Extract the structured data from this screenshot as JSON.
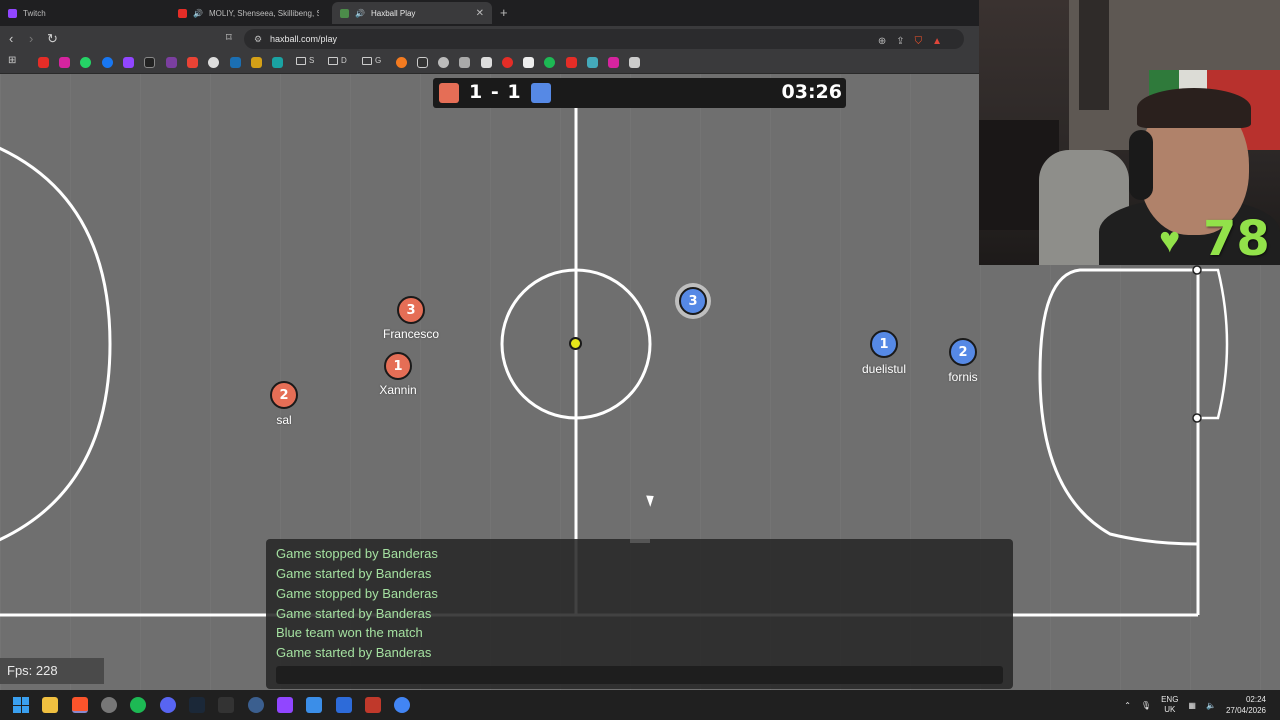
{
  "tabs": [
    {
      "title": "Twitch",
      "color": "#9146ff"
    },
    {
      "title": "MOLIY, Shenseea, Skillibeng, Silent",
      "color": "#e52d27"
    },
    {
      "title": "Haxball Play",
      "color": "#4c8c4a",
      "close": "✕"
    }
  ],
  "browser": {
    "url": "haxball.com/play",
    "new_tab": "+",
    "back": "‹",
    "forward": "›",
    "reload": "↻",
    "bookmark_icon": "🔖",
    "url_lock_icon": "⚲"
  },
  "bookmark_folders": [
    "S",
    "D",
    "G"
  ],
  "game": {
    "score": "1 - 1",
    "time": "03:26",
    "red_color": "#e56e56",
    "blue_color": "#5689e5",
    "red_players": [
      {
        "number": "3",
        "name": "Francesco"
      },
      {
        "number": "1",
        "name": "Xannin"
      },
      {
        "number": "2",
        "name": "sal"
      }
    ],
    "blue_players": [
      {
        "number": "3",
        "name": ""
      },
      {
        "number": "1",
        "name": "duelistul"
      },
      {
        "number": "2",
        "name": "fornis"
      }
    ]
  },
  "chat": {
    "messages": [
      "Game stopped by Banderas",
      "Game started by Banderas",
      "Game stopped by Banderas",
      "Game started by Banderas",
      "Blue team won the match",
      "Game started by Banderas"
    ],
    "input_value": ""
  },
  "fps": "Fps: 228",
  "webcam": {
    "heart": "♥",
    "count": "78"
  },
  "taskbar": {
    "lang_top": "ENG",
    "lang_bottom": "UK",
    "time": "02:24",
    "date": "27/04/2026"
  }
}
